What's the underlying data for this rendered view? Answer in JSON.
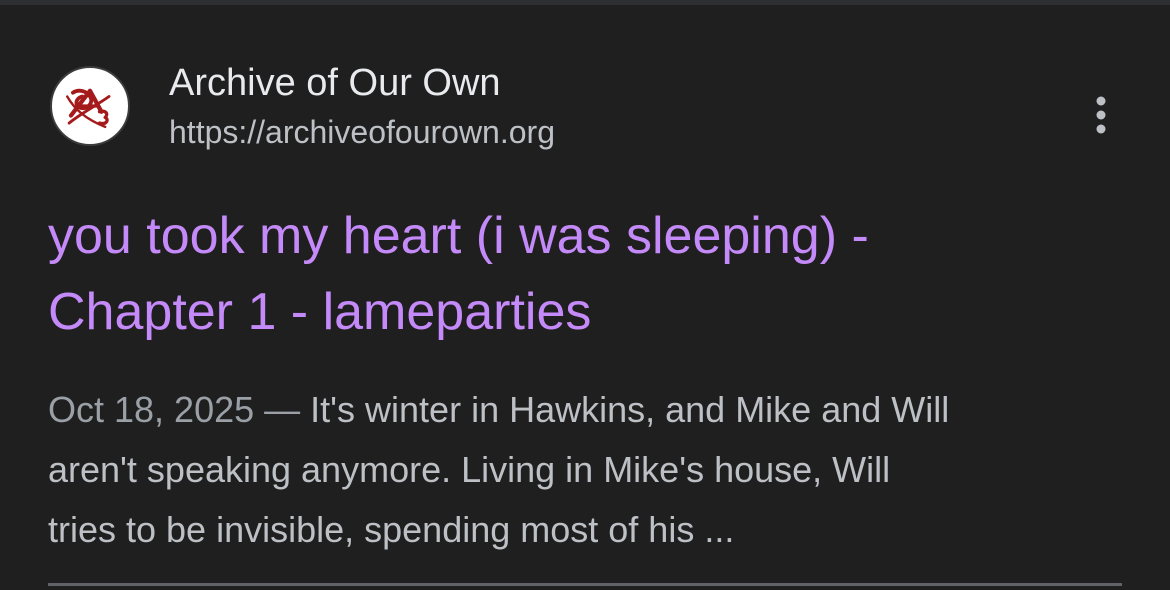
{
  "result": {
    "site_name": "Archive of Our Own",
    "site_url": "https://archiveofourown.org",
    "favicon_icon": "ao3-logo-icon",
    "more_icon": "more-vert-icon",
    "title_line1": "you took my heart (i was sleeping) -",
    "title_line2": "Chapter 1 - lameparties",
    "date": "Oct 18, 2025",
    "separator": " — ",
    "snippet_line1": "It's winter in Hawkins, and Mike and Will",
    "snippet_line2": "aren't speaking anymore. Living in Mike's house, Will",
    "snippet_line3": "tries to be invisible, spending most of his ..."
  },
  "colors": {
    "background": "#1f1f1f",
    "title_link": "#c58af9",
    "site_name": "#e8eaed",
    "secondary_text": "#bdc1c6",
    "date": "#9aa0a6",
    "logo_red": "#a51b1b"
  }
}
